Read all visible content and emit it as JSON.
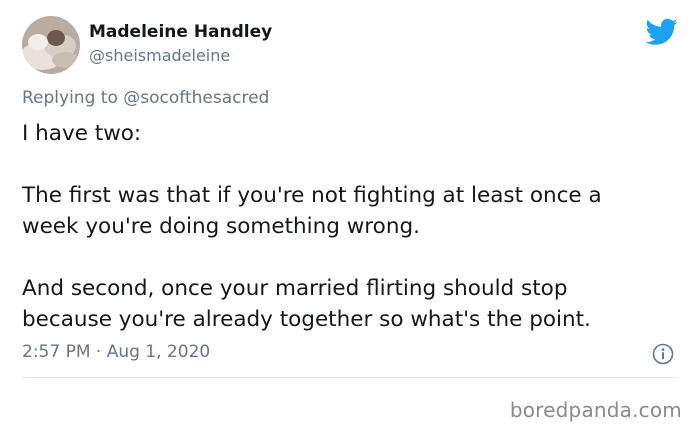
{
  "author": {
    "name": "Madeleine Handley",
    "handle": "@sheismadeleine"
  },
  "reply": {
    "prefix": "Replying to",
    "mention": "@socofthesacred"
  },
  "tweet": {
    "lines": [
      "I have two:",
      "The first was that if you're not fighting at least once a",
      "week you're doing something wrong.",
      "And second, once your married flirting should stop",
      "because you're already together so what's the point."
    ],
    "time": "2:57 PM · Aug 1, 2020"
  },
  "icons": {
    "bird": "twitter-bird-icon",
    "info": "info-icon"
  },
  "colors": {
    "twitter_blue": "#1da1f2",
    "secondary_text": "#657786",
    "divider": "#e1e8ed"
  },
  "watermark": "boredpanda.com"
}
